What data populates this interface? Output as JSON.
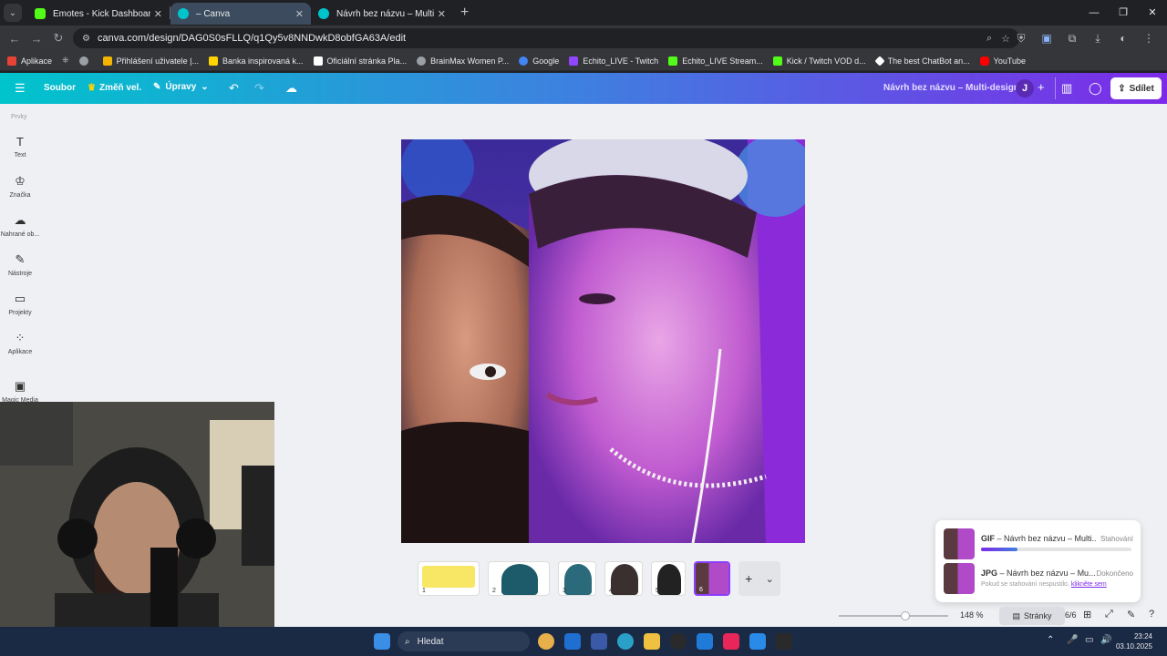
{
  "browser": {
    "tabs": [
      {
        "title": "Emotes - Kick Dashboard",
        "favicon_color": "#53fc18"
      },
      {
        "title": "– Canva",
        "favicon_color": "#00c4cc"
      },
      {
        "title": "Návrh bez názvu – Multi-design",
        "favicon_color": "#00c4cc"
      }
    ],
    "url": "canva.com/design/DAG0S0sFLLQ/q1Qy5v8NNDwkD8obfGA63A/edit",
    "bookmarks": [
      {
        "label": "Aplikace",
        "color": "#e8eaed"
      },
      {
        "label": "Přihlášení uživatele |...",
        "color": "#f4b400"
      },
      {
        "label": "Banka inspirovaná k...",
        "color": "#ffd400"
      },
      {
        "label": "Oficiální stránka Pla...",
        "color": "#ffffff"
      },
      {
        "label": "BrainMax Women P...",
        "color": "#9aa0a6"
      },
      {
        "label": "Google",
        "color": "#4285f4"
      },
      {
        "label": "Echito_LIVE - Twitch",
        "color": "#9146ff"
      },
      {
        "label": "Echito_LIVE Stream...",
        "color": "#53fc18"
      },
      {
        "label": "Kick / Twitch VOD d...",
        "color": "#53fc18"
      },
      {
        "label": "The best ChatBot an...",
        "color": "#ffffff"
      },
      {
        "label": "YouTube",
        "color": "#ff0000"
      }
    ]
  },
  "canva": {
    "toolbar": {
      "file": "Soubor",
      "resize": "Změň vel.",
      "edit": "Úpravy",
      "title": "Návrh bez názvu – Multi-design",
      "avatar": "J",
      "share": "Sdílet"
    },
    "sidebar": {
      "header": "Prvky",
      "items": [
        {
          "label": "Text",
          "icon": "T"
        },
        {
          "label": "Značka",
          "icon": "♔"
        },
        {
          "label": "Nahrané ob...",
          "icon": "☁"
        },
        {
          "label": "Nástroje",
          "icon": "✎"
        },
        {
          "label": "Projekty",
          "icon": "▭"
        },
        {
          "label": "Aplikace",
          "icon": "⁘"
        },
        {
          "label": "Magic Media",
          "icon": "▣"
        }
      ]
    },
    "pages": [
      {
        "number": "1",
        "color": "#f7e24a"
      },
      {
        "number": "2",
        "color": "#1d5a6a"
      },
      {
        "number": "3",
        "color": "#2a6a7a"
      },
      {
        "number": "4",
        "color": "#3a3030"
      },
      {
        "number": "5",
        "color": "#222222"
      },
      {
        "number": "6",
        "color": "#9a3ab0"
      }
    ],
    "downloads": [
      {
        "type": "GIF",
        "name": " – Návrh bez názvu – Multi...",
        "status": "Stahování",
        "progress": 0.24
      },
      {
        "type": "JPG",
        "name": " – Návrh bez názvu – Mu...",
        "status": "Dokončeno",
        "note": "Pokud se stahování nespustilo, ",
        "link": "klikněte sem"
      }
    ],
    "zoom": "148 %",
    "zoom_level": 0.62,
    "pages_label": "Stránky",
    "page_count": "6/6"
  },
  "taskbar": {
    "search": "Hledat",
    "time": "23:24",
    "date": "03.10.2025"
  }
}
